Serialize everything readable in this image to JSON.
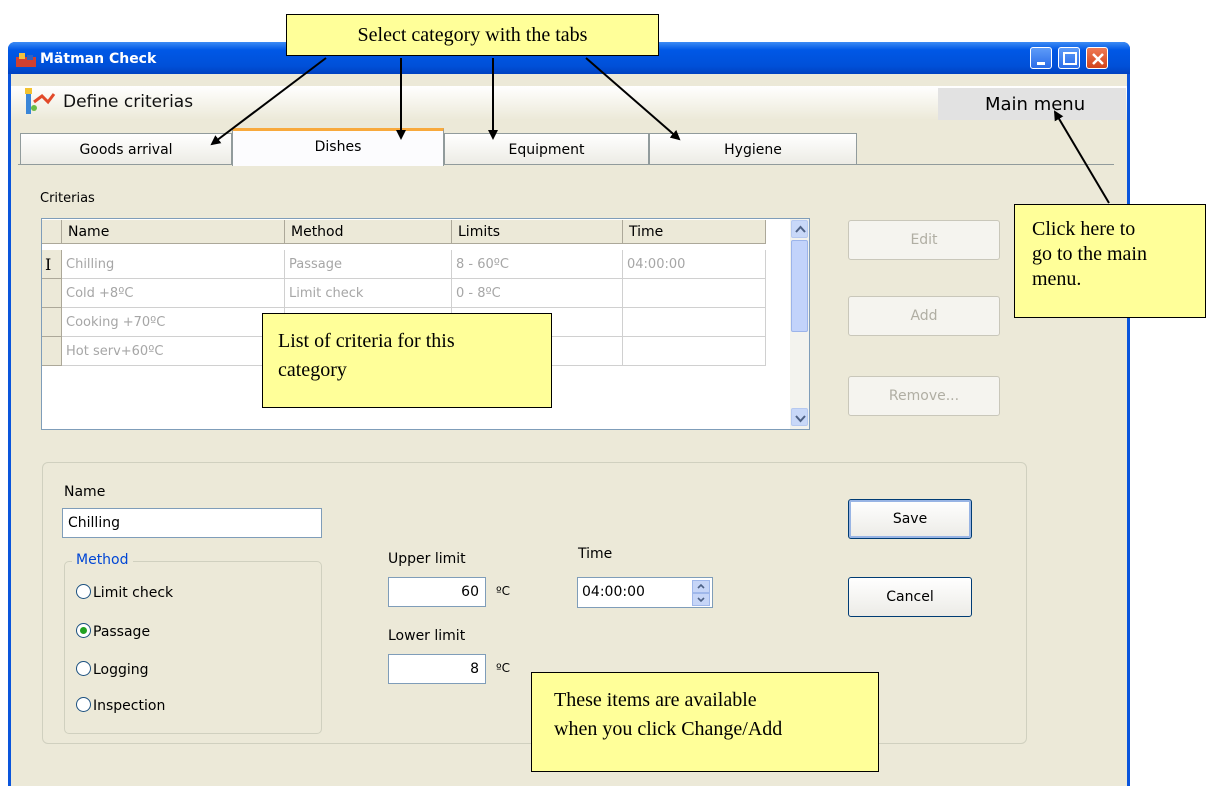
{
  "window": {
    "title": "Mätman Check",
    "app_icon": "app-logo-icon",
    "controls": [
      "minimize-icon",
      "maximize-icon",
      "close-icon"
    ]
  },
  "header": {
    "icon": "define-criteria-icon",
    "title": "Define criterias",
    "main_menu": "Main menu"
  },
  "tabs": [
    {
      "label": "Goods arrival",
      "selected": false
    },
    {
      "label": "Dishes",
      "selected": true
    },
    {
      "label": "Equipment",
      "selected": false
    },
    {
      "label": "Hygiene",
      "selected": false
    }
  ],
  "criterias": {
    "label": "Criterias",
    "columns": [
      "Name",
      "Method",
      "Limits",
      "Time"
    ],
    "row_marker": "I",
    "rows": [
      {
        "name": "Chilling",
        "method": "Passage",
        "limits": "8 - 60ºC",
        "time": "04:00:00"
      },
      {
        "name": "Cold +8ºC",
        "method": "Limit check",
        "limits": "0 - 8ºC",
        "time": ""
      },
      {
        "name": "Cooking +70ºC",
        "method": "",
        "limits": "",
        "time": ""
      },
      {
        "name": "Hot serv+60ºC",
        "method": "",
        "limits": "",
        "time": ""
      }
    ]
  },
  "actions": {
    "edit": "Edit",
    "add": "Add",
    "remove": "Remove..."
  },
  "edit": {
    "name_label": "Name",
    "name_value": "Chilling",
    "method_legend": "Method",
    "methods": [
      {
        "label": "Limit check",
        "checked": false
      },
      {
        "label": "Passage",
        "checked": true
      },
      {
        "label": "Logging",
        "checked": false
      },
      {
        "label": "Inspection",
        "checked": false
      }
    ],
    "upper_label": "Upper limit",
    "upper_value": "60",
    "lower_label": "Lower limit",
    "lower_value": "8",
    "unit": "ºC",
    "time_label": "Time",
    "time_value": "04:00:00",
    "save": "Save",
    "cancel": "Cancel"
  },
  "annotations": {
    "tabs_hint": "Select category with the tabs",
    "main_menu_hint_1": "Click here to",
    "main_menu_hint_2": "go to the main",
    "main_menu_hint_3": "menu.",
    "list_hint_1": "List of criteria for this",
    "list_hint_2": "category",
    "items_hint_1": "These items are available",
    "items_hint_2": "when you click Change/Add"
  }
}
